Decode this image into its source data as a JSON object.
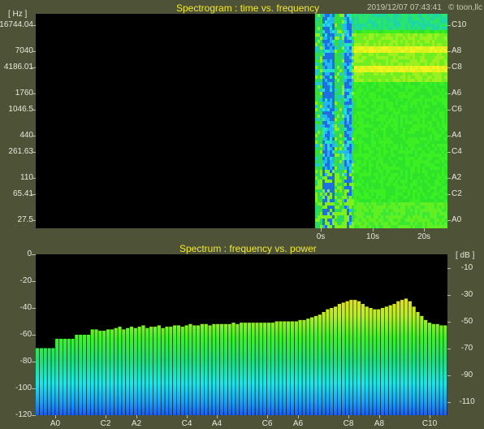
{
  "spectrogram": {
    "title": "Spectrogram : time vs. frequency",
    "timestamp": "2019/12/07 07:43:41",
    "copyright": "© toon,llc",
    "unit_label": "[ Hz ]",
    "freq_labels": [
      "16744.04",
      "7040",
      "4186.01",
      "1760",
      "1046.5",
      "440",
      "261.63",
      "110",
      "65.41",
      "27.5"
    ],
    "note_labels": [
      "C10",
      "A8",
      "C8",
      "A6",
      "C6",
      "A4",
      "C4",
      "A2",
      "C2",
      "A0"
    ],
    "time_labels": [
      "0s",
      "10s",
      "20s"
    ]
  },
  "spectrum": {
    "title": "Spectrum : frequency vs. power",
    "unit_label": "[ dB ]",
    "left_labels": [
      "0",
      "-20",
      "-40",
      "-60",
      "-80",
      "-100",
      "-120"
    ],
    "right_labels": [
      "-10",
      "-30",
      "-50",
      "-70",
      "-90",
      "-110"
    ],
    "note_labels": [
      "A0",
      "C2",
      "A2",
      "C4",
      "A4",
      "C6",
      "A6",
      "C8",
      "A8",
      "C10"
    ]
  },
  "chart_data": [
    {
      "type": "heatmap",
      "title": "Spectrogram : time vs. frequency",
      "y_tick_labels": [
        "16744.04",
        "7040",
        "4186.01",
        "1760",
        "1046.5",
        "440",
        "261.63",
        "110",
        "65.41",
        "27.5"
      ],
      "x_tick_labels": [
        "0s",
        "10s",
        "20s"
      ],
      "y_scale": "log"
    },
    {
      "type": "bar",
      "title": "Spectrum : frequency vs. power",
      "ylim": [
        -120,
        0
      ],
      "y_tick_labels": [
        "0",
        "-20",
        "-40",
        "-60",
        "-80",
        "-100",
        "-120"
      ],
      "x_tick_labels": [
        "A0",
        "C2",
        "A2",
        "C4",
        "A4",
        "C6",
        "A6",
        "C8",
        "A8",
        "C10"
      ],
      "values": [
        -70,
        -70,
        -70,
        -70,
        -70,
        -63,
        -63,
        -63,
        -63,
        -63,
        -60,
        -60,
        -60,
        -60,
        -56,
        -56,
        -57,
        -57,
        -56,
        -56,
        -55,
        -54,
        -56,
        -55,
        -54,
        -55,
        -54,
        -53,
        -55,
        -54,
        -54,
        -53,
        -55,
        -54,
        -54,
        -53,
        -53,
        -54,
        -53,
        -52,
        -53,
        -53,
        -52,
        -52,
        -53,
        -52,
        -52,
        -52,
        -52,
        -52,
        -51,
        -52,
        -51,
        -51,
        -51,
        -51,
        -51,
        -51,
        -51,
        -51,
        -51,
        -50,
        -50,
        -50,
        -50,
        -50,
        -50,
        -49,
        -49,
        -48,
        -47,
        -46,
        -45,
        -43,
        -41,
        -40,
        -39,
        -37,
        -36,
        -35,
        -34,
        -34,
        -35,
        -37,
        -39,
        -40,
        -41,
        -41,
        -40,
        -39,
        -38,
        -37,
        -35,
        -34,
        -33,
        -35,
        -39,
        -43,
        -46,
        -49,
        -51,
        -52,
        -52,
        -53,
        -53
      ]
    }
  ]
}
